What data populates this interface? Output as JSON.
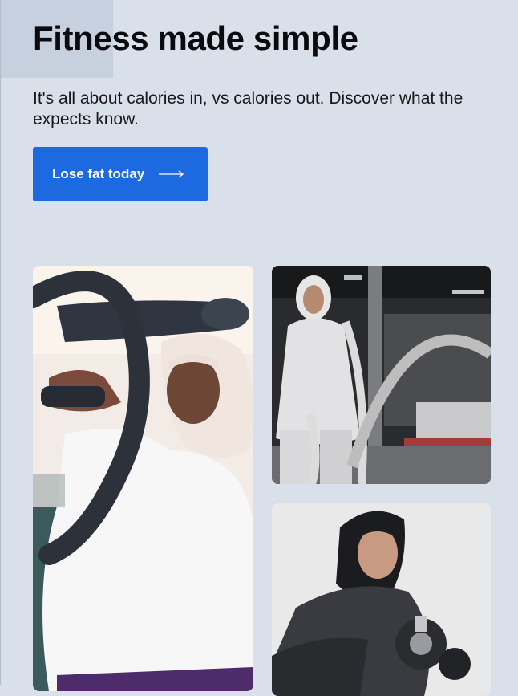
{
  "hero": {
    "title": "Fitness made simple",
    "subtitle": "It's all about calories in, vs calories out. Discover what the expects know."
  },
  "cta": {
    "label": "Lose fat today",
    "icon": "arrow-right-icon"
  },
  "colors": {
    "page_background": "#d9e0ea",
    "accent": "#1d6ae0"
  }
}
